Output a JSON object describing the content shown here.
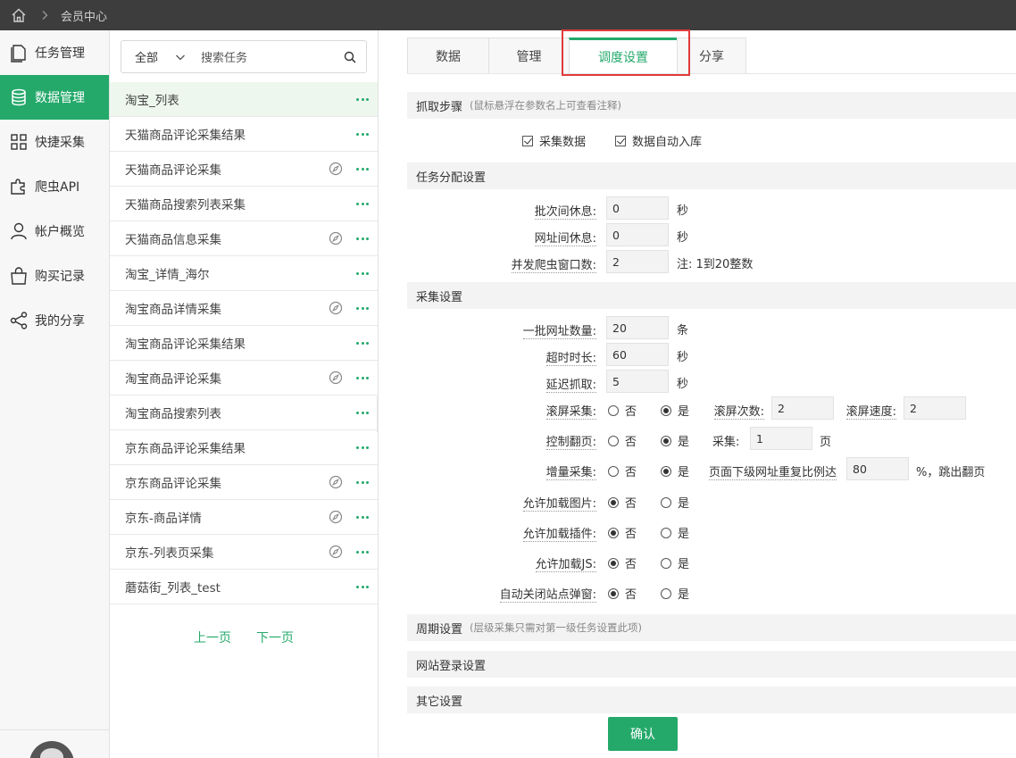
{
  "topbar": {
    "breadcrumb": "会员中心"
  },
  "nav": {
    "items": [
      {
        "label": "任务管理",
        "icon": "document-icon"
      },
      {
        "label": "数据管理",
        "icon": "database-icon"
      },
      {
        "label": "快捷采集",
        "icon": "grid-icon"
      },
      {
        "label": "爬虫API",
        "icon": "plugin-icon"
      },
      {
        "label": "帐户概览",
        "icon": "user-icon"
      },
      {
        "label": "购买记录",
        "icon": "bag-icon"
      },
      {
        "label": "我的分享",
        "icon": "share-icon"
      }
    ],
    "active_index": 1
  },
  "tasklist": {
    "scope": "全部",
    "search_placeholder": "搜索任务",
    "rows": [
      {
        "name": "淘宝_列表",
        "compass": false
      },
      {
        "name": "天猫商品评论采集结果",
        "compass": false
      },
      {
        "name": "天猫商品评论采集",
        "compass": true
      },
      {
        "name": "天猫商品搜索列表采集",
        "compass": false
      },
      {
        "name": "天猫商品信息采集",
        "compass": true
      },
      {
        "name": "淘宝_详情_海尔",
        "compass": false
      },
      {
        "name": "淘宝商品详情采集",
        "compass": true
      },
      {
        "name": "淘宝商品评论采集结果",
        "compass": false
      },
      {
        "name": "淘宝商品评论采集",
        "compass": true
      },
      {
        "name": "淘宝商品搜索列表",
        "compass": false
      },
      {
        "name": "京东商品评论采集结果",
        "compass": false
      },
      {
        "name": "京东商品评论采集",
        "compass": true
      },
      {
        "name": "京东-商品详情",
        "compass": true
      },
      {
        "name": "京东-列表页采集",
        "compass": true
      },
      {
        "name": "蘑菇街_列表_test",
        "compass": false
      }
    ],
    "prev": "上一页",
    "next": "下一页"
  },
  "tabs": [
    {
      "label": "数据"
    },
    {
      "label": "管理"
    },
    {
      "label": "调度设置"
    },
    {
      "label": "分享"
    }
  ],
  "active_tab": 2,
  "sections": {
    "steps": {
      "title": "抓取步骤",
      "note": "(鼠标悬浮在参数名上可查看注释)"
    },
    "dist": {
      "title": "任务分配设置"
    },
    "collect": {
      "title": "采集设置"
    },
    "period": {
      "title": "周期设置",
      "note": "(层级采集只需对第一级任务设置此项)"
    },
    "login": {
      "title": "网站登录设置"
    },
    "other": {
      "title": "其它设置"
    }
  },
  "steps": {
    "collect_data": "采集数据",
    "auto_store": "数据自动入库"
  },
  "dist": {
    "batch_rest_label": "批次间休息:",
    "batch_rest_value": "0",
    "batch_rest_unit": "秒",
    "url_rest_label": "网址间休息:",
    "url_rest_value": "0",
    "url_rest_unit": "秒",
    "concurrency_label": "并发爬虫窗口数:",
    "concurrency_value": "2",
    "concurrency_note": "注: 1到20整数"
  },
  "collect": {
    "batch_label": "一批网址数量:",
    "batch_value": "20",
    "batch_unit": "条",
    "timeout_label": "超时时长:",
    "timeout_value": "60",
    "timeout_unit": "秒",
    "delay_label": "延迟抓取:",
    "delay_value": "5",
    "delay_unit": "秒",
    "scroll_label": "滚屏采集:",
    "scroll_times_label": "滚屏次数:",
    "scroll_times_value": "2",
    "scroll_speed_label": "滚屏速度:",
    "scroll_speed_value": "2",
    "page_label": "控制翻页:",
    "page_collect_label": "采集:",
    "page_value": "1",
    "page_unit": "页",
    "incr_label": "增量采集:",
    "incr_desc": "页面下级网址重复比例达",
    "incr_value": "80",
    "incr_tail": "%，跳出翻页",
    "img_label": "允许加载图片:",
    "plugin_label": "允许加载插件:",
    "js_label": "允许加载JS:",
    "popup_label": "自动关闭站点弹窗:",
    "no": "否",
    "yes": "是"
  },
  "confirm": "确认"
}
